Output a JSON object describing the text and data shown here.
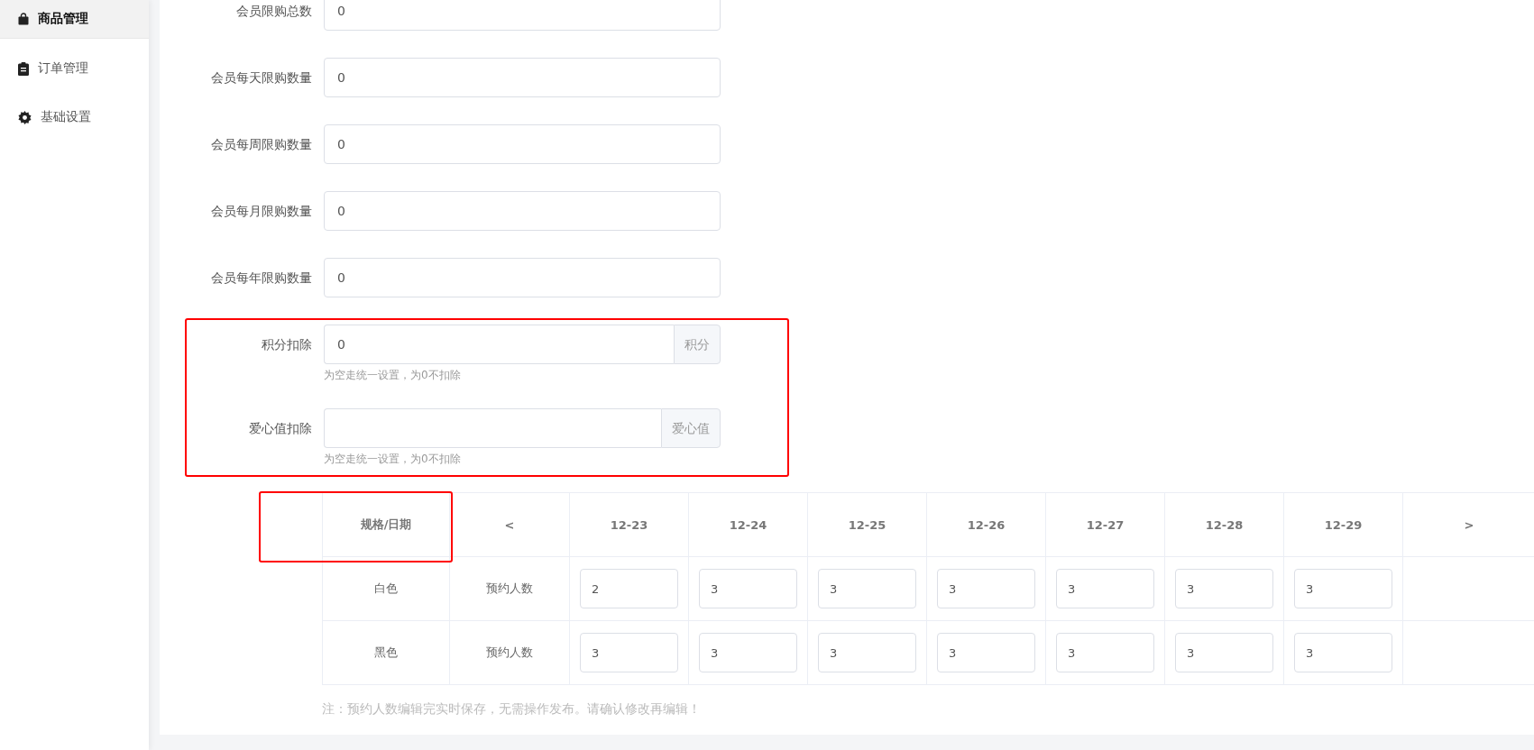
{
  "sidebar": {
    "items": [
      {
        "label": "商品管理",
        "kind": "bag",
        "selected": true
      },
      {
        "label": "订单管理",
        "kind": "clipboard",
        "selected": false
      },
      {
        "label": "基础设置",
        "kind": "gear",
        "selected": false
      }
    ]
  },
  "form": {
    "fields": [
      {
        "kind": "plain",
        "label": "会员限购总数",
        "value": "0"
      },
      {
        "kind": "plain",
        "label": "会员每天限购数量",
        "value": "0"
      },
      {
        "kind": "plain",
        "label": "会员每周限购数量",
        "value": "0"
      },
      {
        "kind": "plain",
        "label": "会员每月限购数量",
        "value": "0"
      },
      {
        "kind": "plain",
        "label": "会员每年限购数量",
        "value": "0"
      },
      {
        "kind": "addon",
        "label": "积分扣除",
        "value": "0",
        "addon": "积分",
        "hint": "为空走统一设置，为0不扣除"
      },
      {
        "kind": "addon",
        "label": "爱心值扣除",
        "addon": "爱心值",
        "hint": "为空走统一设置，为0不扣除"
      }
    ]
  },
  "table": {
    "corner": "规格/日期",
    "prev": "<",
    "next": ">",
    "dates": [
      "12-23",
      "12-24",
      "12-25",
      "12-26",
      "12-27",
      "12-28",
      "12-29"
    ],
    "rows": [
      {
        "spec": "白色",
        "label": "预约人数",
        "values": [
          "2",
          "3",
          "3",
          "3",
          "3",
          "3",
          "3"
        ]
      },
      {
        "spec": "黑色",
        "label": "预约人数",
        "values": [
          "3",
          "3",
          "3",
          "3",
          "3",
          "3",
          "3"
        ]
      }
    ]
  },
  "note": "注：预约人数编辑完实时保存，无需操作发布。请确认修改再编辑！"
}
